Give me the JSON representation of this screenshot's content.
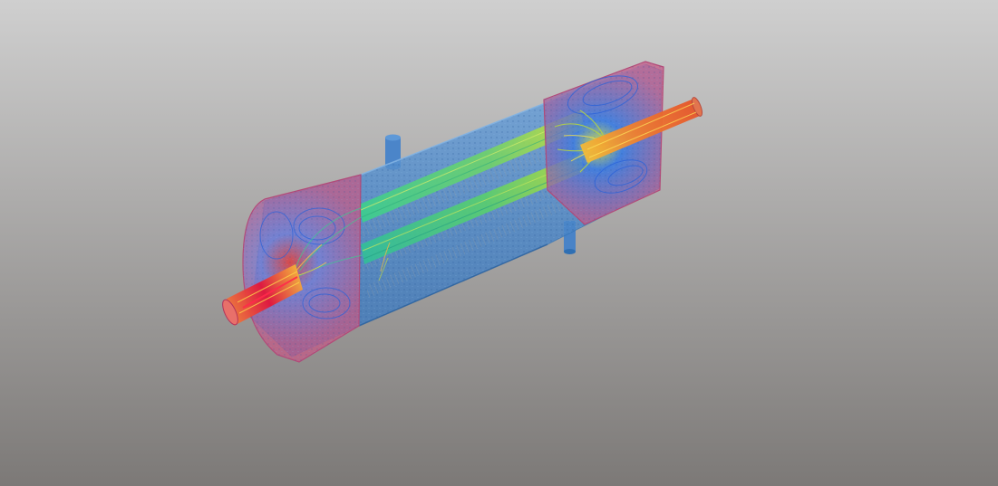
{
  "viewport": {
    "background_top": "#cfcfcf",
    "background_bottom": "#7c7977"
  },
  "colors": {
    "shell": "#4a86c8",
    "shell_edge": "#2f6fb3",
    "end_cap": "#c9587a",
    "hot": "#e3153a",
    "warm": "#f2a52a",
    "mid": "#b8d83a",
    "cool": "#37c48a",
    "cold": "#2c63d8",
    "nozzle": "#3f7fcb"
  },
  "icons": {
    "scene": "heat-exchanger-cfd-streamlines-icon"
  }
}
